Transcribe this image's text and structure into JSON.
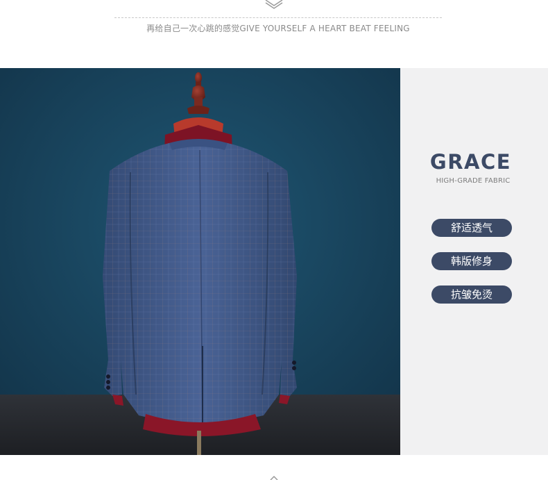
{
  "header": {
    "tagline": "再给自己一次心跳的感觉GIVE YOURSELF A HEART BEAT FEELING"
  },
  "feature": {
    "title": "GRACE",
    "subtitle": "HIGH-GRADE FABRIC",
    "tags": [
      "舒适透气",
      "韩版修身",
      "抗皱免烫"
    ]
  },
  "photo": {
    "subject": "suit-jacket-back-on-mannequin"
  },
  "colors": {
    "accent": "#3c4a66",
    "panel_bg": "#f1f1f2",
    "backdrop": "#1b4560",
    "fabric": "#3f5a8c",
    "lining": "#7d1325"
  }
}
